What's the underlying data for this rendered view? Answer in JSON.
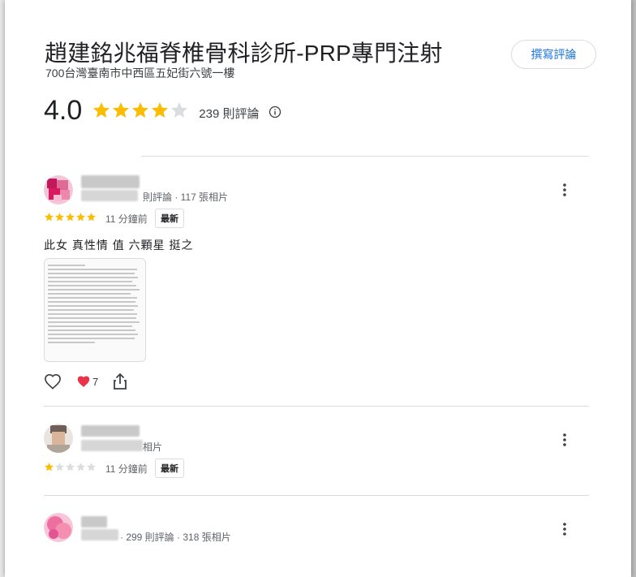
{
  "place": {
    "name": "趙建銘兆福脊椎骨科診所-PRP專門注射",
    "address": "700台灣臺南市中西區五妃街六號一樓",
    "write_review_label": "撰寫評論",
    "rating": "4.0",
    "rating_stars": 4,
    "review_count_label": "239 則評論"
  },
  "reviews": [
    {
      "meta": "則評論 · 117 張相片",
      "stars": 5,
      "time": "11 分鐘前",
      "badge": "最新",
      "text": "此女 真性情 值 六顆星 挺之",
      "has_photo": true,
      "reaction_count": "7"
    },
    {
      "meta": "相片",
      "stars": 1,
      "time": "11 分鐘前",
      "badge": "最新"
    },
    {
      "meta": "· 299 則評論 · 318 張相片"
    }
  ],
  "colors": {
    "star_filled": "#fbbc04",
    "star_empty": "#dadce0",
    "accent": "#1a73e8",
    "heart": "#e8334a"
  }
}
